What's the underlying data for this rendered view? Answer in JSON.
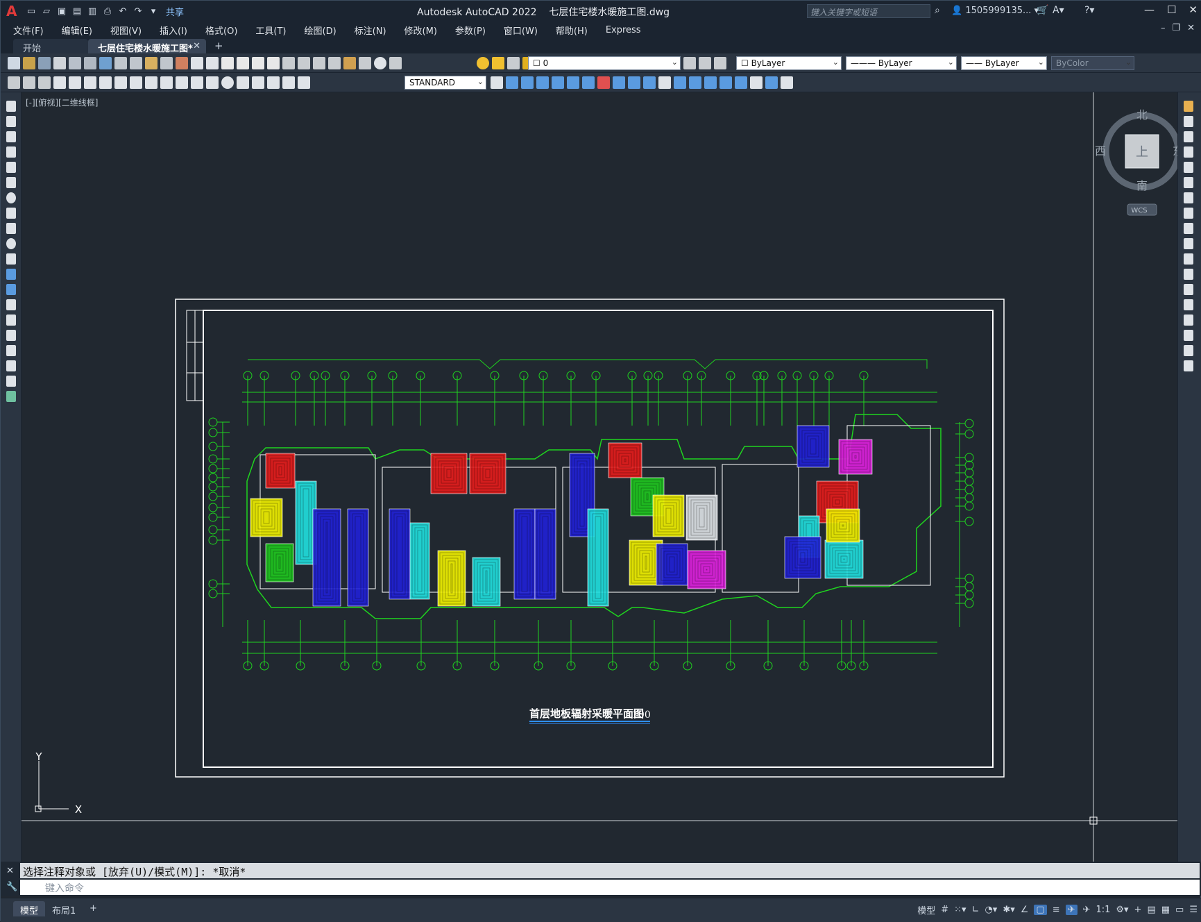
{
  "titlebar": {
    "app_title": "Autodesk AutoCAD 2022",
    "doc_title": "七层住宅楼水暖施工图.dwg",
    "share": "共享",
    "search_placeholder": "键入关键字或短语",
    "user": "1505999135..."
  },
  "menu": [
    "文件(F)",
    "编辑(E)",
    "视图(V)",
    "插入(I)",
    "格式(O)",
    "工具(T)",
    "绘图(D)",
    "标注(N)",
    "修改(M)",
    "参数(P)",
    "窗口(W)",
    "帮助(H)",
    "Express"
  ],
  "tabs": {
    "start": "开始",
    "active": "七层住宅楼水暖施工图*"
  },
  "toolbar": {
    "layer_value": "0",
    "color_value": "ByLayer",
    "linetype_value": "ByLayer",
    "lineweight_value": "ByLayer",
    "plotstyle_value": "ByColor",
    "textstyle_value": "STANDARD"
  },
  "canvas": {
    "view_label": "[-][俯视][二维线框]",
    "compass": {
      "north": "北",
      "south": "南",
      "east": "东",
      "west": "西",
      "top": "上",
      "wcs": "WCS"
    },
    "drawing_title": "首层地板辐射采暖平面图",
    "drawing_scale": "100",
    "ucs_x": "X",
    "ucs_y": "Y"
  },
  "command": {
    "history": "选择注释对象或 [放弃(U)/模式(M)]: *取消*",
    "prompt_placeholder": "键入命令"
  },
  "status": {
    "model_tab": "模型",
    "layout_tab": "布局1",
    "model_label": "模型",
    "scale": "1:1"
  }
}
